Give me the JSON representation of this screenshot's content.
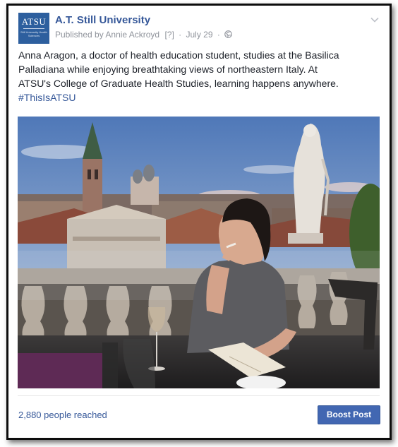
{
  "post": {
    "page_name": "A.T. Still University",
    "avatar": {
      "main": "ATSU",
      "sub": "Still University Health Sciences"
    },
    "published_by": "Published by Annie Ackroyd",
    "help_marker": "[?]",
    "separator": "·",
    "date": "July 29",
    "text_lines": [
      "Anna Aragon, a doctor of health education student, studies at the Basilica",
      "Palladiana while enjoying breathtaking views of northeastern Italy. At",
      "ATSU's College of Graduate Health Studies, learning happens anywhere."
    ],
    "hashtag": "#ThisIsATSU",
    "image_description_icon": "photo",
    "icons": {
      "audience": "globe-icon",
      "menu": "chevron-down-icon"
    }
  },
  "footer": {
    "reach": "2,880 people reached",
    "boost_label": "Boost Post"
  },
  "colors": {
    "link": "#365899",
    "boost_bg": "#4267b2",
    "meta": "#90949c",
    "avatar_bg": "#2d5f9e"
  }
}
